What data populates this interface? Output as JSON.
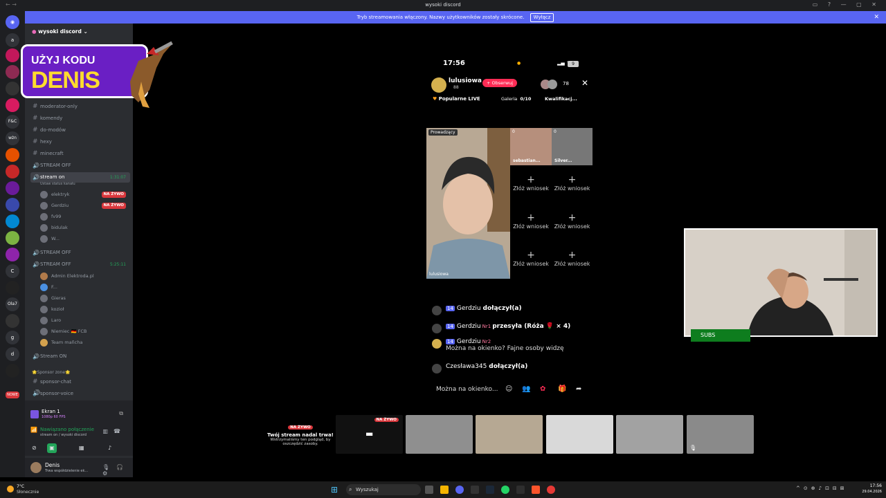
{
  "window": {
    "title": "wysoki discord"
  },
  "banner": {
    "text": "Tryb streamowania włączony. Nazwy użytkowników zostały skrócone.",
    "button": "Wyłącz"
  },
  "guilds": [
    "a",
    "F&C",
    "wżn",
    "C",
    "Ola7",
    "g",
    "d",
    "NOWE"
  ],
  "server": {
    "name": "wysoki discord"
  },
  "promo": {
    "line1": "UŻYJ KODU",
    "line2": "DENIS"
  },
  "channels": [
    {
      "name": "moderator-only"
    },
    {
      "name": "komendy"
    },
    {
      "name": "do-modów"
    },
    {
      "name": "hexy"
    },
    {
      "name": "minecraft"
    }
  ],
  "stream_off_1": "STREAM OFF",
  "stream_on": {
    "name": "stream on",
    "timer": "1:31:07",
    "status": "Ustaw status kanału"
  },
  "voice_users_a": [
    {
      "name": "elektryk",
      "badge": "NA ŻYWO"
    },
    {
      "name": "Gerdziu",
      "badge": "NA ŻYWO"
    },
    {
      "name": "fv99",
      "badge": ""
    },
    {
      "name": "bidulak",
      "badge": ""
    },
    {
      "name": "W...",
      "badge": ""
    }
  ],
  "stream_off_2": "STREAM OFF",
  "stream_off_3": {
    "name": "STREAM OFF",
    "timer": "5:25:11"
  },
  "voice_users_b": [
    "Admin Elektroda.pl",
    "F...",
    "Gieras",
    "kozioł",
    "Laro",
    "Niemiec 🇩🇪 FCB",
    "Team mañcha"
  ],
  "stream_on_ch": "Stream ON",
  "sponsor_cat": "🌟Sponsor zone🌟",
  "sponsor_channels": [
    "sponsor-chat",
    "sponsor-voice"
  ],
  "voice_panel": {
    "screen": "Ekran 1",
    "quality": "1080p 60 FPS",
    "status": "Nawiązano połączenie",
    "where": "stream on / wysoki discord"
  },
  "user": {
    "name": "Denis",
    "status": "Trwa współdzielenie ek..."
  },
  "phone": {
    "time": "17:56",
    "battery": "9",
    "host": "lulusiowa",
    "host_sub": "88",
    "follow": "+ Obserwuj",
    "viewers": "78",
    "tab1": "Popularne LIVE",
    "tab2": "Galeria",
    "tab2_val": "0/10",
    "tab3": "Kwalifikacj...",
    "lead_label": "Prowadzący",
    "lead_name": "lulusiowa",
    "guest1": "sebastian...",
    "guest2": "Silver...",
    "guest_score": "0",
    "request": "Złóż wniosek"
  },
  "chat": [
    {
      "lvl": "14",
      "user": "Gerdziu",
      "text": "dołączył(a)",
      "nr": ""
    },
    {
      "lvl": "14",
      "user": "Gerdziu",
      "text": "przesyła (Róża 🌹 × 4)",
      "nr": "Nr1"
    },
    {
      "lvl": "14",
      "user": "Gerdziu",
      "text": "Można na okienko? Fajne osoby widzę",
      "nr": "Nr2"
    },
    {
      "lvl": "",
      "user": "Czesława345",
      "text": "dołączył(a)",
      "nr": ""
    }
  ],
  "chat_input": "Można na okienko...",
  "subs": "SUBS",
  "stream_notice": {
    "title": "Twój stream nadal trwa!",
    "body": "Wstrzymaliśmy ten podgląd, by oszczędzić zasoby.",
    "badge": "NA ŻYWO"
  },
  "taskbar": {
    "weather_temp": "7°C",
    "weather_desc": "Słonecznie",
    "search": "Wyszukaj",
    "time": "17:56",
    "date": "29.04.2026"
  }
}
